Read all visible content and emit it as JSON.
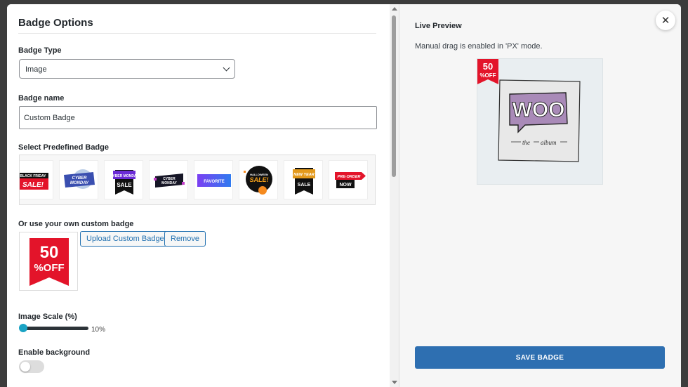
{
  "left_panel": {
    "title": "Badge Options",
    "badge_type": {
      "label": "Badge Type",
      "value": "Image"
    },
    "badge_name": {
      "label": "Badge name",
      "value": "Custom Badge"
    },
    "predefined": {
      "label": "Select Predefined Badge",
      "items": [
        {
          "name": "black-friday-sale",
          "text1": "BLACK FRIDAY",
          "text2": "SALE!"
        },
        {
          "name": "cyber-monday-blue",
          "text1": "CYBER",
          "text2": "MONDAY"
        },
        {
          "name": "cyber-monday-sale",
          "text1": "CYBER MONDAY",
          "text2": "SALE"
        },
        {
          "name": "cyber-monday-dark",
          "text1": "CYBER",
          "text2": "MONDAY"
        },
        {
          "name": "favorite",
          "text1": "FAVORITE"
        },
        {
          "name": "halloween-sale",
          "text1": "HALLOWEEN",
          "text2": "SALE!"
        },
        {
          "name": "new-year-sale",
          "text1": "NEW YEAR",
          "text2": "SALE"
        },
        {
          "name": "pre-order-now",
          "text1": "PRE-ORDER",
          "text2": "NOW"
        }
      ]
    },
    "custom": {
      "label": "Or use your own custom badge",
      "upload_label": "Upload Custom Badge",
      "remove_label": "Remove",
      "badge_text1": "50",
      "badge_text2": "%OFF"
    },
    "scale": {
      "label": "Image Scale (%)",
      "value": "10%",
      "fraction": 0.1
    },
    "background": {
      "label": "Enable background",
      "enabled": false
    }
  },
  "right_panel": {
    "title": "Live Preview",
    "note": "Manual drag is enabled in 'PX' mode.",
    "product": {
      "logo": "WOO",
      "caption1": "the",
      "caption2": "album"
    },
    "badge_text1": "50",
    "badge_text2": "%OFF",
    "save_label": "SAVE BADGE"
  },
  "close_label": "✕",
  "colors": {
    "accent": "#2e6fb1",
    "badge_red": "#e3142a",
    "slider_thumb": "#1aa3c4"
  }
}
